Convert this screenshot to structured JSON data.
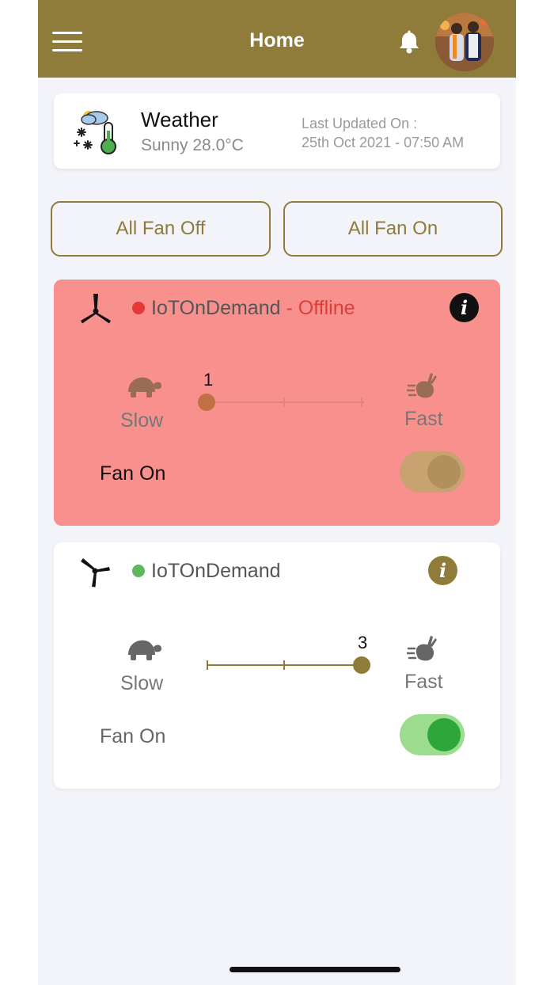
{
  "header": {
    "title": "Home",
    "menu_icon": "hamburger-menu-icon",
    "bell_icon": "bell-icon",
    "brand_color": "#8f7b3a"
  },
  "weather": {
    "title": "Weather",
    "condition": "Sunny 28.0°C",
    "updated_label": "Last Updated On :",
    "updated_value": "25th Oct 2021 - 07:50 AM",
    "icon": "weather-icon"
  },
  "actions": {
    "all_off": "All Fan Off",
    "all_on": "All Fan On"
  },
  "devices": [
    {
      "name": "IoTOnDemand",
      "status_suffix": " - Offline",
      "status_color": "#e53935",
      "card_color": "#f8918d",
      "speed": 1,
      "speed_min": 1,
      "speed_max": 3,
      "slow_label": "Slow",
      "fast_label": "Fast",
      "toggle_label": "Fan On",
      "toggle_on": true
    },
    {
      "name": "IoTOnDemand",
      "status_suffix": "",
      "status_color": "#5cb85c",
      "card_color": "#ffffff",
      "speed": 3,
      "speed_min": 1,
      "speed_max": 3,
      "slow_label": "Slow",
      "fast_label": "Fast",
      "toggle_label": "Fan On",
      "toggle_on": true
    }
  ]
}
